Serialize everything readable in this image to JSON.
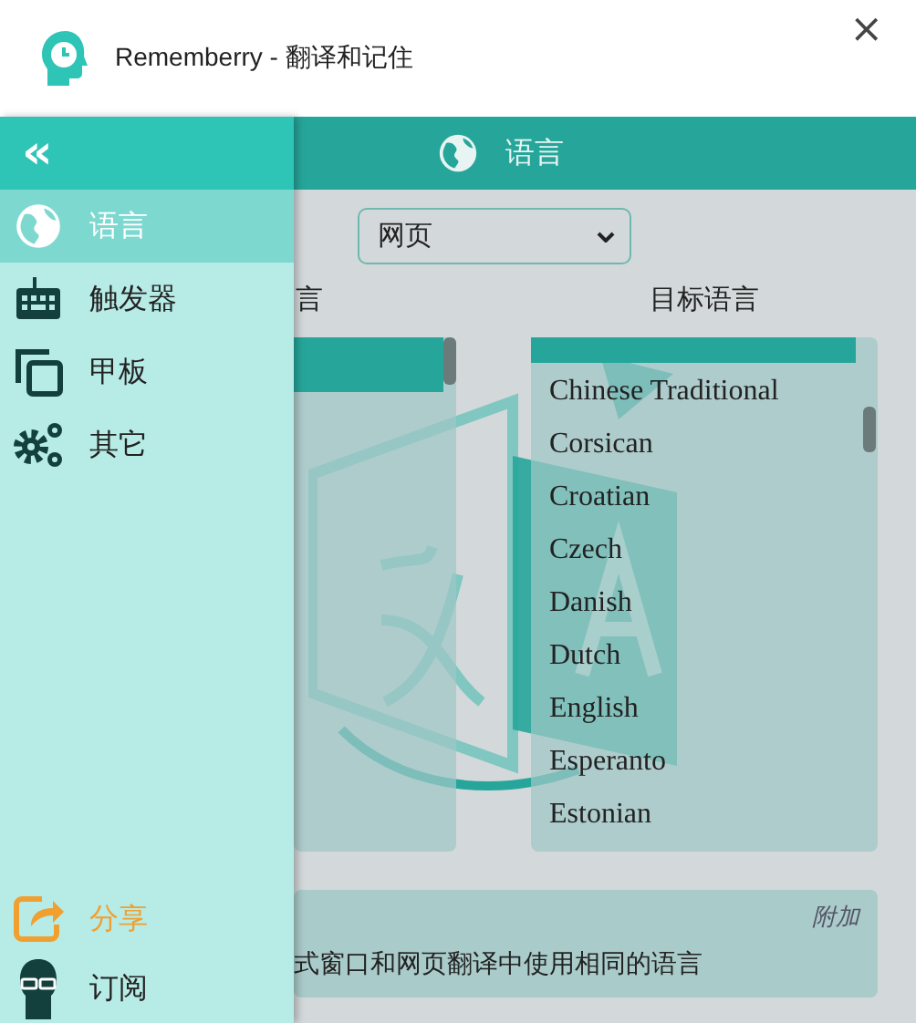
{
  "window": {
    "title": "Rememberry - 翻译和记住",
    "close": "×"
  },
  "header": {
    "collapse": "«",
    "title": "语言"
  },
  "drawer": {
    "items": [
      {
        "label": "语言",
        "kind": "globe",
        "selected": true
      },
      {
        "label": "触发器",
        "kind": "keyboard",
        "selected": false
      },
      {
        "label": "甲板",
        "kind": "copy",
        "selected": false
      },
      {
        "label": "其它",
        "kind": "gears",
        "selected": false
      }
    ],
    "bottom_items": [
      {
        "label": "分享",
        "kind": "share"
      },
      {
        "label": "订阅",
        "kind": "subscribe"
      }
    ]
  },
  "content": {
    "mode_select": {
      "value": "网页"
    },
    "source": {
      "label": "言",
      "highlight": true
    },
    "target": {
      "label": "目标语言",
      "highlight": true,
      "items": [
        "Chinese Traditional",
        "Corsican",
        "Croatian",
        "Czech",
        "Danish",
        "Dutch",
        "English",
        "Esperanto",
        "Estonian"
      ]
    },
    "extra": {
      "badge": "附加",
      "text": "式窗口和网页翻译中使用相同的语言"
    }
  }
}
